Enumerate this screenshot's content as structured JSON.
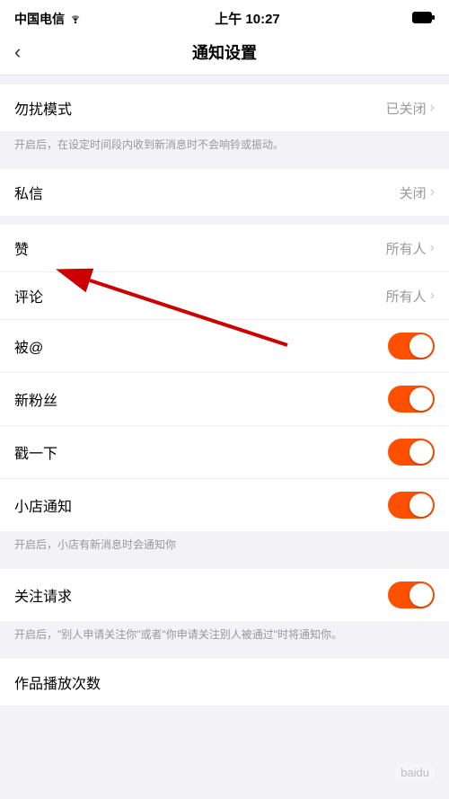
{
  "statusBar": {
    "carrier": "中国电信",
    "time": "上午 10:27",
    "battery": "full"
  },
  "navBar": {
    "title": "通知设置",
    "backLabel": "‹"
  },
  "sections": [
    {
      "id": "doNotDisturb",
      "items": [
        {
          "label": "勿扰模式",
          "rightText": "已关闭",
          "type": "link"
        }
      ],
      "desc": "开启后，在设定时间段内收到新消息时不会响铃或振动。"
    },
    {
      "id": "messages",
      "items": [
        {
          "label": "私信",
          "rightText": "关闭",
          "type": "link"
        }
      ]
    },
    {
      "id": "interactions",
      "items": [
        {
          "label": "赞",
          "rightText": "所有人",
          "type": "link"
        },
        {
          "label": "评论",
          "rightText": "所有人",
          "type": "link"
        },
        {
          "label": "被@",
          "rightText": "",
          "type": "toggle",
          "toggleOn": true
        },
        {
          "label": "新粉丝",
          "rightText": "",
          "type": "toggle",
          "toggleOn": true
        },
        {
          "label": "戳一下",
          "rightText": "",
          "type": "toggle",
          "toggleOn": true
        },
        {
          "label": "小店通知",
          "rightText": "",
          "type": "toggle",
          "toggleOn": true
        }
      ],
      "desc": "开启后，小店有新消息时会通知你"
    },
    {
      "id": "followRequest",
      "items": [
        {
          "label": "关注请求",
          "rightText": "",
          "type": "toggle",
          "toggleOn": true
        }
      ],
      "desc": "开启后，\"别人申请关注你\"或者\"你申请关注别人被通过\"时将通知你。"
    },
    {
      "id": "playCount",
      "items": [
        {
          "label": "作品播放次数",
          "rightText": "",
          "type": "none"
        }
      ]
    }
  ],
  "watermark": "Baidu",
  "arrow": {
    "visible": true
  }
}
